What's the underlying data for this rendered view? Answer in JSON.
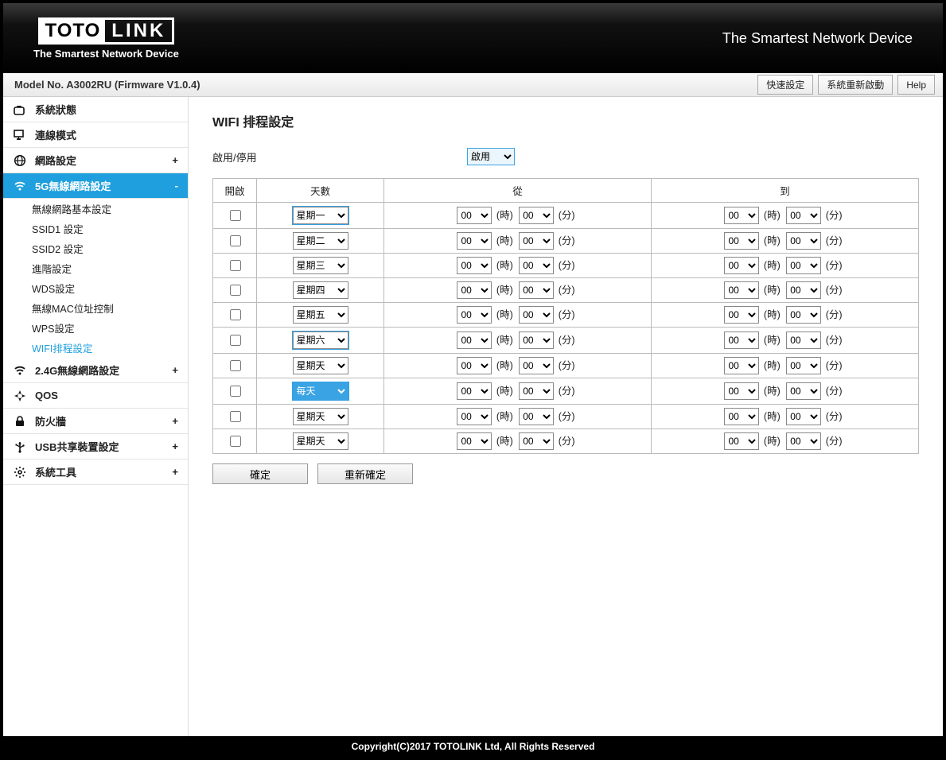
{
  "header": {
    "logo_primary": "TOTO",
    "logo_secondary": "LINK",
    "logo_subtitle": "The Smartest Network Device",
    "slogan": "The Smartest Network Device"
  },
  "model_bar": {
    "text": "Model No. A3002RU (Firmware V1.0.4)",
    "buttons": {
      "quick": "快速設定",
      "reboot": "系統重新啟動",
      "help": "Help"
    }
  },
  "sidebar": {
    "items": [
      {
        "icon": "status",
        "label": "系統狀態",
        "exp": "",
        "active": false
      },
      {
        "icon": "conn",
        "label": "連線模式",
        "exp": "",
        "active": false
      },
      {
        "icon": "globe",
        "label": "網路設定",
        "exp": "+",
        "active": false
      },
      {
        "icon": "wifi",
        "label": "5G無線網路設定",
        "exp": "-",
        "active": true
      },
      {
        "icon": "wifi",
        "label": "2.4G無線網路設定",
        "exp": "+",
        "active": false,
        "pad": true
      },
      {
        "icon": "qos",
        "label": "QOS",
        "exp": "",
        "active": false
      },
      {
        "icon": "lock",
        "label": "防火牆",
        "exp": "+",
        "active": false
      },
      {
        "icon": "usb",
        "label": "USB共享裝置設定",
        "exp": "+",
        "active": false
      },
      {
        "icon": "gear",
        "label": "系統工具",
        "exp": "+",
        "active": false
      }
    ],
    "sub5g": [
      {
        "label": "無線網路基本設定"
      },
      {
        "label": "SSID1 設定"
      },
      {
        "label": "SSID2 設定"
      },
      {
        "label": "進階設定"
      },
      {
        "label": "WDS設定"
      },
      {
        "label": "無線MAC位址控制"
      },
      {
        "label": "WPS設定"
      },
      {
        "label": "WIFI排程設定",
        "selected": true
      }
    ]
  },
  "page": {
    "title": "WIFI 排程設定",
    "enable_label": "啟用/停用",
    "enable_value": "啟用",
    "columns": {
      "enable": "開啟",
      "day": "天數",
      "from": "從",
      "to": "到"
    },
    "hour_label": "(時)",
    "min_label": "(分)",
    "rows": [
      {
        "day": "星期一",
        "fh": "00",
        "fm": "00",
        "th": "00",
        "tm": "00",
        "hl": true
      },
      {
        "day": "星期二",
        "fh": "00",
        "fm": "00",
        "th": "00",
        "tm": "00"
      },
      {
        "day": "星期三",
        "fh": "00",
        "fm": "00",
        "th": "00",
        "tm": "00"
      },
      {
        "day": "星期四",
        "fh": "00",
        "fm": "00",
        "th": "00",
        "tm": "00"
      },
      {
        "day": "星期五",
        "fh": "00",
        "fm": "00",
        "th": "00",
        "tm": "00"
      },
      {
        "day": "星期六",
        "fh": "00",
        "fm": "00",
        "th": "00",
        "tm": "00",
        "hl": true
      },
      {
        "day": "星期天",
        "fh": "00",
        "fm": "00",
        "th": "00",
        "tm": "00"
      },
      {
        "day": "每天",
        "fh": "00",
        "fm": "00",
        "th": "00",
        "tm": "00",
        "blue": true,
        "hl": true
      },
      {
        "day": "星期天",
        "fh": "00",
        "fm": "00",
        "th": "00",
        "tm": "00"
      },
      {
        "day": "星期天",
        "fh": "00",
        "fm": "00",
        "th": "00",
        "tm": "00"
      }
    ],
    "btn_ok": "確定",
    "btn_reset": "重新確定"
  },
  "footer": "Copyright(C)2017 TOTOLINK Ltd, All Rights Reserved"
}
